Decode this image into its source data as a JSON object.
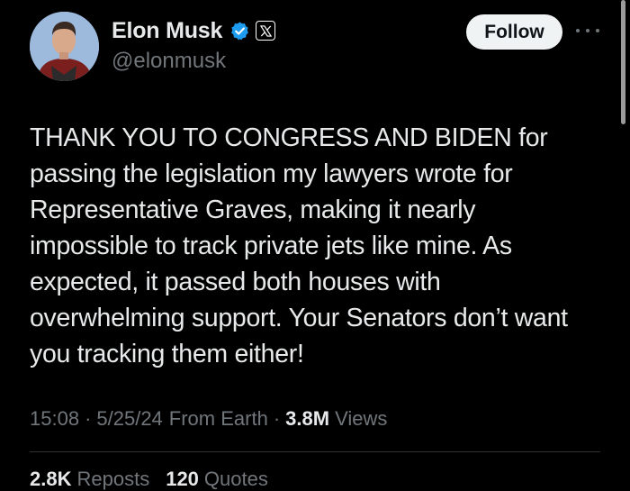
{
  "author": {
    "display_name": "Elon Musk",
    "handle": "@elonmusk",
    "verified_icon": "verified-badge-icon",
    "affiliation_icon": "x-logo-icon"
  },
  "actions": {
    "follow_label": "Follow",
    "more_icon": "more-horizontal-icon"
  },
  "tweet": {
    "text": "THANK YOU TO CONGRESS AND BIDEN for passing the legislation my lawyers wrote for Representative Graves, making it nearly impossible to track private jets like mine. As expected, it passed both houses with overwhelming support. Your Senators don’t want you tracking them either!"
  },
  "meta": {
    "time": "15:08",
    "separator": "·",
    "date": "5/25/24",
    "source": "From Earth",
    "views_count": "3.8M",
    "views_label": "Views"
  },
  "stats": {
    "reposts_count": "2.8K",
    "reposts_label": "Reposts",
    "quotes_count": "120",
    "quotes_label": "Quotes"
  },
  "colors": {
    "background": "#000000",
    "text_primary": "#e7e9ea",
    "text_secondary": "#71767b",
    "verified_blue": "#1d9bf0",
    "follow_button_bg": "#eff3f4",
    "divider": "#2f3336"
  }
}
